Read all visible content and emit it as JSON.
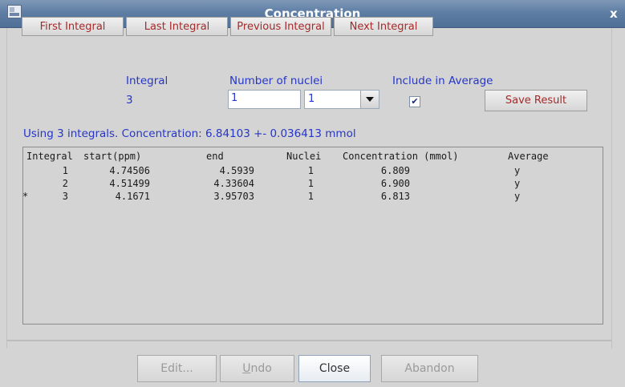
{
  "window": {
    "title": "Concentration",
    "close": "x"
  },
  "nav": [
    "First Integral",
    "Last Integral",
    "Previous Integral",
    "Next Integral"
  ],
  "fields": {
    "integral_label": "Integral",
    "integral_value": "3",
    "nuclei_label": "Number of nuclei",
    "nuclei_input": "1",
    "nuclei_select": "1",
    "include_label": "Include in Average",
    "include_checked": "✔",
    "save": "Save Result"
  },
  "concentration_text": "Using 3 integrals. Concentration: 6.84103 +- 0.036413 mmol",
  "table": {
    "headers": [
      "Integral",
      "start(ppm)",
      "end",
      "Nuclei",
      "Concentration (mmol)",
      "Average"
    ],
    "rows": [
      {
        "marker": "",
        "integral": "1",
        "start": "4.74506",
        "end": "4.5939",
        "nuclei": "1",
        "conc": "6.809",
        "avg": "y"
      },
      {
        "marker": "",
        "integral": "2",
        "start": "4.51499",
        "end": "4.33604",
        "nuclei": "1",
        "conc": "6.900",
        "avg": "y"
      },
      {
        "marker": "*",
        "integral": "3",
        "start": "4.1671",
        "end": "3.95703",
        "nuclei": "1",
        "conc": "6.813",
        "avg": "y"
      }
    ]
  },
  "bottom_buttons": {
    "edit": "Edit...",
    "undo_u": "U",
    "undo_rest": "ndo",
    "close": "Close",
    "abandon": "Abandon"
  },
  "icons": {
    "app": "app-icon",
    "dropdown": "chevron-down-icon",
    "check": "checkmark-icon"
  }
}
